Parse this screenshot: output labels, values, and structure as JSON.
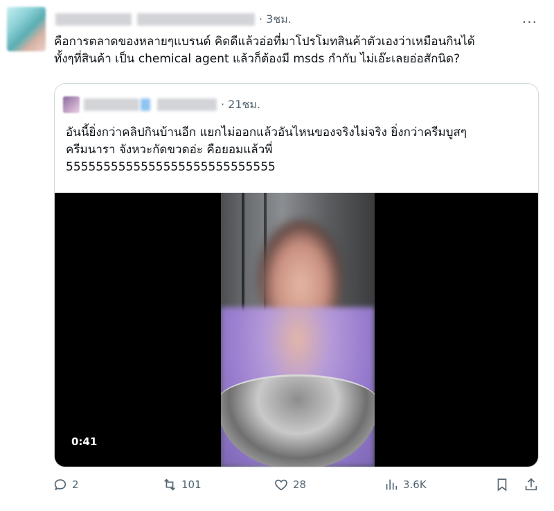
{
  "tweet": {
    "timestamp": "· 3ชม.",
    "more_label": "···",
    "text_line1": "คือการตลาดของหลายๆแบรนด์ คิดดีแล้วอ่อที่มาโปรโมทสินค้าตัวเองว่าเหมือนกินได้",
    "text_line2": "ทั้งๆที่สินค้า เป็น chemical agent แล้วก็ต้องมี msds กำกับ ไม่เอ๊ะเลยอ่อสักนิด?"
  },
  "quote": {
    "timestamp": "· 21ชม.",
    "text_line1": "อันนี้ยิ่งกว่าคลิปกินบ้านอีก แยกไม่ออกแล้วอันไหนของจริงไม่จริง ยิ่งกว่าครีมบูสๆ",
    "text_line2": "ครีมนารา จังหวะกัดขวดอ่ะ คือยอมแล้วพี่",
    "text_line3": "5555555555555555555555555555",
    "video_duration": "0:41"
  },
  "actions": {
    "reply_count": "2",
    "retweet_count": "101",
    "like_count": "28",
    "views_count": "3.6K"
  },
  "icons": {
    "reply": "reply-icon",
    "retweet": "retweet-icon",
    "like": "heart-icon",
    "views": "views-icon",
    "bookmark": "bookmark-icon",
    "share": "share-icon"
  },
  "colors": {
    "muted": "#536471",
    "border": "#cfd9de"
  }
}
